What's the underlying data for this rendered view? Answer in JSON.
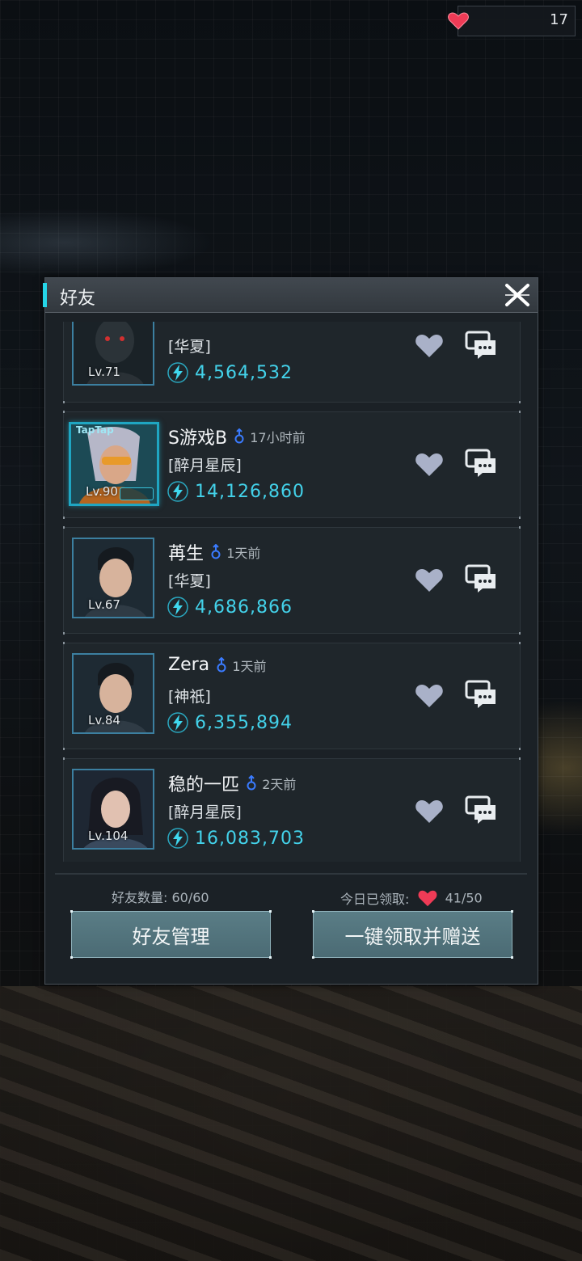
{
  "top_hud": {
    "hearts": "17"
  },
  "dialog": {
    "title": "好友",
    "friends": [
      {
        "name": "",
        "last_seen": "",
        "guild": "[华夏]",
        "level": "Lv.71",
        "power": "4,564,532",
        "taptap": false
      },
      {
        "name": "S游戏B",
        "last_seen": "17小时前",
        "guild": "[醉月星辰]",
        "level": "Lv.90",
        "power": "14,126,860",
        "taptap": true,
        "badge": "TapTap"
      },
      {
        "name": "苒生",
        "last_seen": "1天前",
        "guild": "[华夏]",
        "level": "Lv.67",
        "power": "4,686,866",
        "taptap": false
      },
      {
        "name": "Zera",
        "last_seen": "1天前",
        "guild": "[神祇]",
        "level": "Lv.84",
        "power": "6,355,894",
        "taptap": false
      },
      {
        "name": "稳的一匹",
        "last_seen": "2天前",
        "guild": "[醉月星辰]",
        "level": "Lv.104",
        "power": "16,083,703",
        "taptap": false
      }
    ],
    "footer": {
      "friend_count_label": "好友数量:",
      "friend_count_value": "60/60",
      "claimed_label": "今日已领取:",
      "claimed_value": "41/50",
      "manage_button": "好友管理",
      "claim_button": "一键领取并赠送"
    }
  },
  "colors": {
    "accent": "#25d6e8",
    "power": "#43d2ea",
    "heart": "#ef3b56",
    "male_icon": "#3a7bff",
    "button": "#52747d"
  },
  "icons": {
    "close": "close-x-icon",
    "gift": "heart-icon",
    "chat": "chat-bubble-icon",
    "power": "lightning-icon",
    "gender": "male-icon"
  }
}
